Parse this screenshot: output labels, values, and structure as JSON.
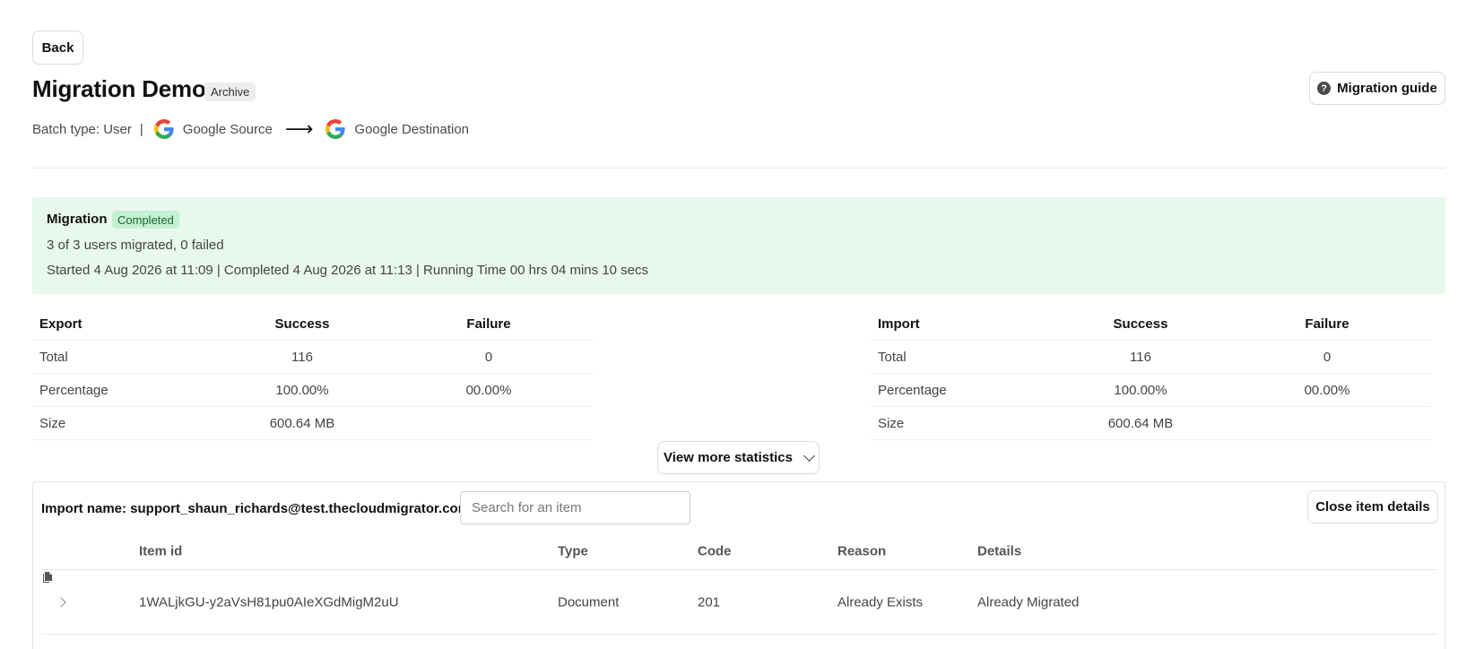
{
  "header": {
    "back_label": "Back",
    "title": "Migration Demo",
    "archive_badge": "Archive",
    "guide_label": "Migration guide",
    "batch_type": "Batch type: User",
    "separator": "|",
    "source_label": "Google Source",
    "destination_label": "Google Destination"
  },
  "status": {
    "label": "Migration",
    "badge": "Completed",
    "users_line": "3 of 3 users migrated, 0 failed",
    "timing_line": "Started 4 Aug 2026 at 11:09 | Completed 4 Aug 2026 at 11:13 | Running Time 00 hrs 04 mins 10 secs",
    "panel_color": "#e8f8ec",
    "badge_color": "#c6f0d2"
  },
  "export_stats": {
    "headers": [
      "Export",
      "Success",
      "Failure"
    ],
    "rows": [
      [
        "Total",
        "116",
        "0"
      ],
      [
        "Percentage",
        "100.00%",
        "00.00%"
      ],
      [
        "Size",
        "600.64 MB",
        ""
      ]
    ]
  },
  "import_stats": {
    "headers": [
      "Import",
      "Success",
      "Failure"
    ],
    "rows": [
      [
        "Total",
        "116",
        "0"
      ],
      [
        "Percentage",
        "100.00%",
        "00.00%"
      ],
      [
        "Size",
        "600.64 MB",
        ""
      ]
    ]
  },
  "view_more_label": "View more statistics",
  "items": {
    "import_name": "Import name: support_shaun_richards@test.thecloudmigrator.com",
    "search_placeholder": "Search for an item",
    "close_label": "Close item details",
    "columns": [
      "Item id",
      "Type",
      "Code",
      "Reason",
      "Details"
    ],
    "rows": [
      {
        "item_id": "1WALjkGU-y2aVsH81pu0AIeXGdMigM2uU",
        "type": "Document",
        "code": "201",
        "reason": "Already Exists",
        "details": "Already Migrated",
        "icon": "document-icon"
      }
    ]
  }
}
